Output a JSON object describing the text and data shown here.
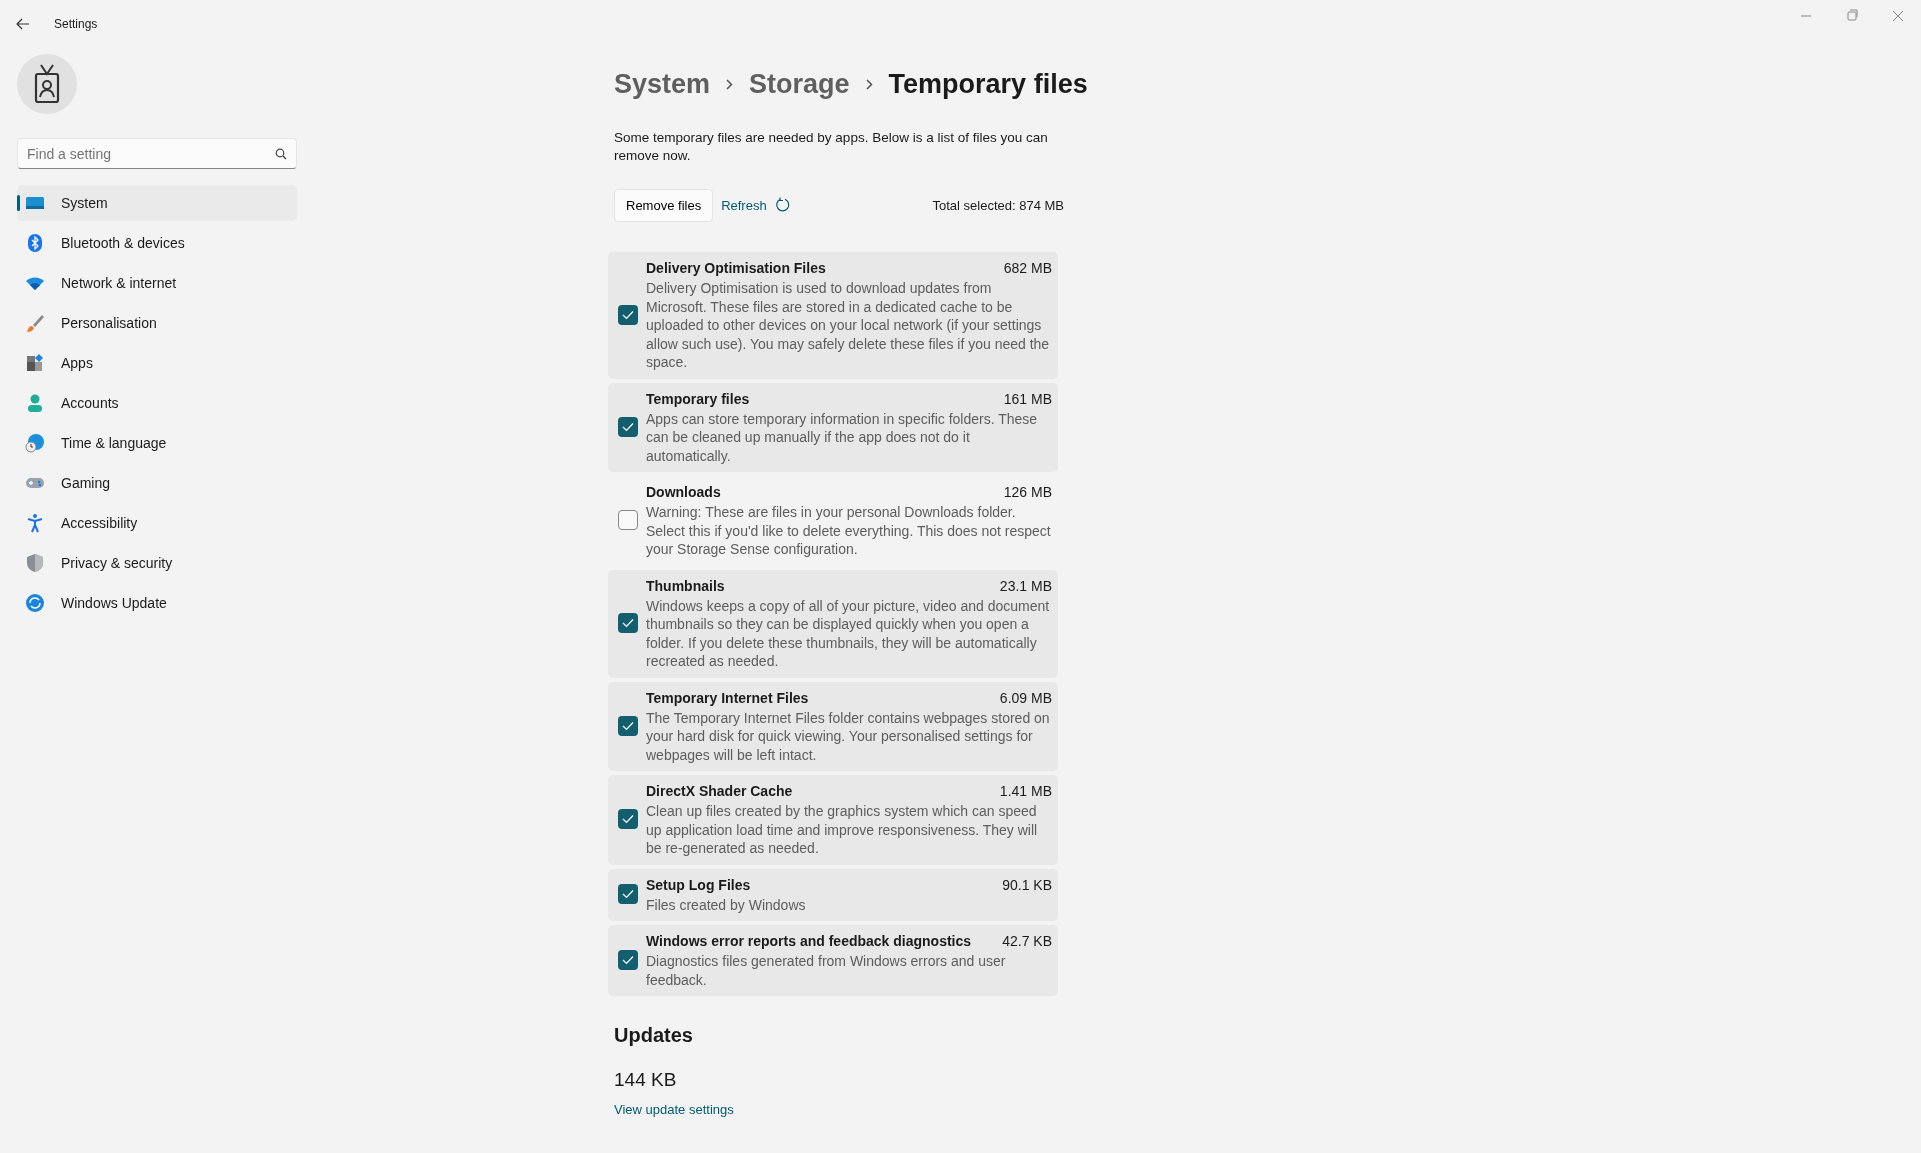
{
  "window": {
    "title": "Settings"
  },
  "search": {
    "placeholder": "Find a setting"
  },
  "sidebar": {
    "items": [
      {
        "label": "System",
        "selected": true
      },
      {
        "label": "Bluetooth & devices",
        "selected": false
      },
      {
        "label": "Network & internet",
        "selected": false
      },
      {
        "label": "Personalisation",
        "selected": false
      },
      {
        "label": "Apps",
        "selected": false
      },
      {
        "label": "Accounts",
        "selected": false
      },
      {
        "label": "Time & language",
        "selected": false
      },
      {
        "label": "Gaming",
        "selected": false
      },
      {
        "label": "Accessibility",
        "selected": false
      },
      {
        "label": "Privacy & security",
        "selected": false
      },
      {
        "label": "Windows Update",
        "selected": false
      }
    ]
  },
  "breadcrumb": [
    "System",
    "Storage",
    "Temporary files"
  ],
  "intro": "Some temporary files are needed by apps. Below is a list of files you can remove now.",
  "actions": {
    "remove": "Remove files",
    "refresh": "Refresh",
    "total": "Total selected: 874 MB"
  },
  "files": [
    {
      "name": "Delivery Optimisation Files",
      "size": "682 MB",
      "description": "Delivery Optimisation is used to download updates from Microsoft. These files are stored in a dedicated cache to be uploaded to other devices on your local network (if your settings allow such use). You may safely delete these files if you need the space.",
      "checked": true
    },
    {
      "name": "Temporary files",
      "size": "161 MB",
      "description": "Apps can store temporary information in specific folders. These can be cleaned up manually if the app does not do it automatically.",
      "checked": true
    },
    {
      "name": "Downloads",
      "size": "126 MB",
      "description": "Warning: These are files in your personal Downloads folder. Select this if you'd like to delete everything. This does not respect your Storage Sense configuration.",
      "checked": false
    },
    {
      "name": "Thumbnails",
      "size": "23.1 MB",
      "description": "Windows keeps a copy of all of your picture, video and document thumbnails so they can be displayed quickly when you open a folder. If you delete these thumbnails, they will be automatically recreated as needed.",
      "checked": true
    },
    {
      "name": "Temporary Internet Files",
      "size": "6.09 MB",
      "description": "The Temporary Internet Files folder contains webpages stored on your hard disk for quick viewing. Your personalised settings for webpages will be left intact.",
      "checked": true
    },
    {
      "name": "DirectX Shader Cache",
      "size": "1.41 MB",
      "description": "Clean up files created by the graphics system which can speed up application load time and improve responsiveness. They will be re-generated as needed.",
      "checked": true
    },
    {
      "name": "Setup Log Files",
      "size": "90.1 KB",
      "description": "Files created by Windows",
      "checked": true
    },
    {
      "name": "Windows error reports and feedback diagnostics",
      "size": "42.7 KB",
      "description": "Diagnostics files generated from Windows errors and user feedback.",
      "checked": true
    }
  ],
  "updates": {
    "heading": "Updates",
    "size": "144 KB",
    "link": "View update settings"
  }
}
